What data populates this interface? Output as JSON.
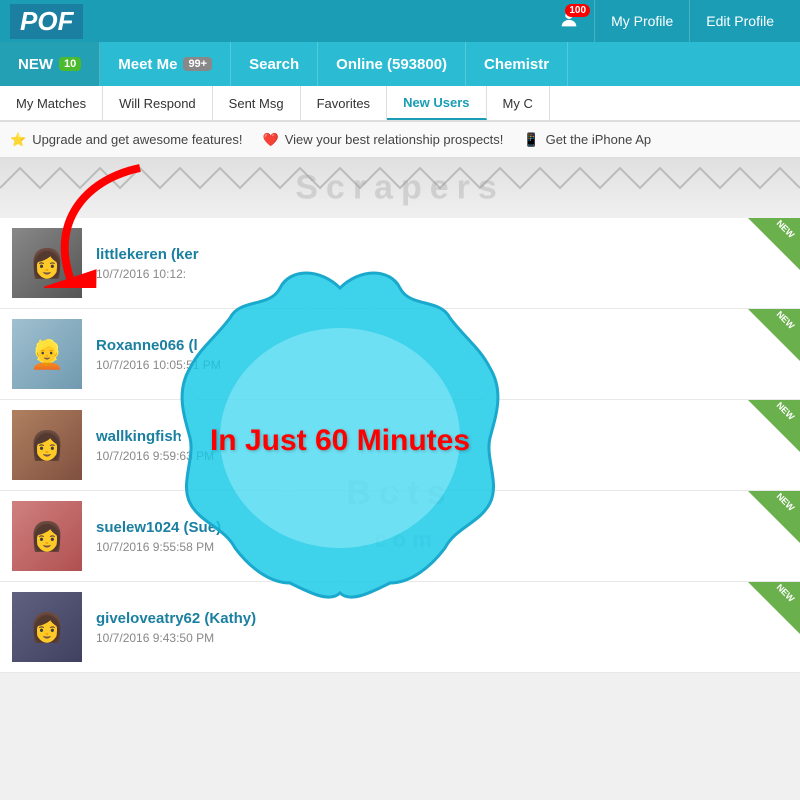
{
  "header": {
    "logo": "POF",
    "notification_count": "100",
    "my_profile": "My Profile",
    "edit_profile": "Edit Profile"
  },
  "navbar": {
    "items": [
      {
        "label": "NEW",
        "badge": "10",
        "badge_type": "green"
      },
      {
        "label": "Meet Me",
        "badge": "99+",
        "badge_type": "gray"
      },
      {
        "label": "Search",
        "badge": "",
        "badge_type": ""
      },
      {
        "label": "Online (593800)",
        "badge": "",
        "badge_type": ""
      },
      {
        "label": "Chemistr",
        "badge": "",
        "badge_type": ""
      }
    ]
  },
  "subnav": {
    "items": [
      {
        "label": "My Matches",
        "active": false
      },
      {
        "label": "Will Respond",
        "active": false
      },
      {
        "label": "Sent Msg",
        "active": false
      },
      {
        "label": "Favorites",
        "active": false
      },
      {
        "label": "New Users",
        "active": true
      },
      {
        "label": "My C",
        "active": false
      }
    ]
  },
  "promo": {
    "items": [
      {
        "icon": "⭐",
        "text": "Upgrade and get awesome features!"
      },
      {
        "icon": "❤️",
        "text": "View your best relationship prospects!"
      },
      {
        "icon": "📱",
        "text": "Get the iPhone Ap"
      }
    ]
  },
  "overlay": {
    "burst_text": "In Just 60 Minutes"
  },
  "watermarks": [
    "Scrapers",
    "Bots",
    ".com"
  ],
  "profiles": [
    {
      "name": "littlekeren (ker",
      "date": "10/7/2016 10:12:",
      "new": true,
      "avatar": "👩"
    },
    {
      "name": "Roxanne066 (l",
      "date": "10/7/2016 10:05:51 PM",
      "new": true,
      "avatar": "👱"
    },
    {
      "name": "wallkingfish",
      "date": "10/7/2016 9:59:63 PM",
      "new": true,
      "avatar": "👩"
    },
    {
      "name": "suelew1024 (Sue)",
      "date": "10/7/2016 9:55:58 PM",
      "new": true,
      "avatar": "👩"
    },
    {
      "name": "giveloveatry62 (Kathy)",
      "date": "10/7/2016 9:43:50 PM",
      "new": true,
      "avatar": "👩"
    }
  ]
}
